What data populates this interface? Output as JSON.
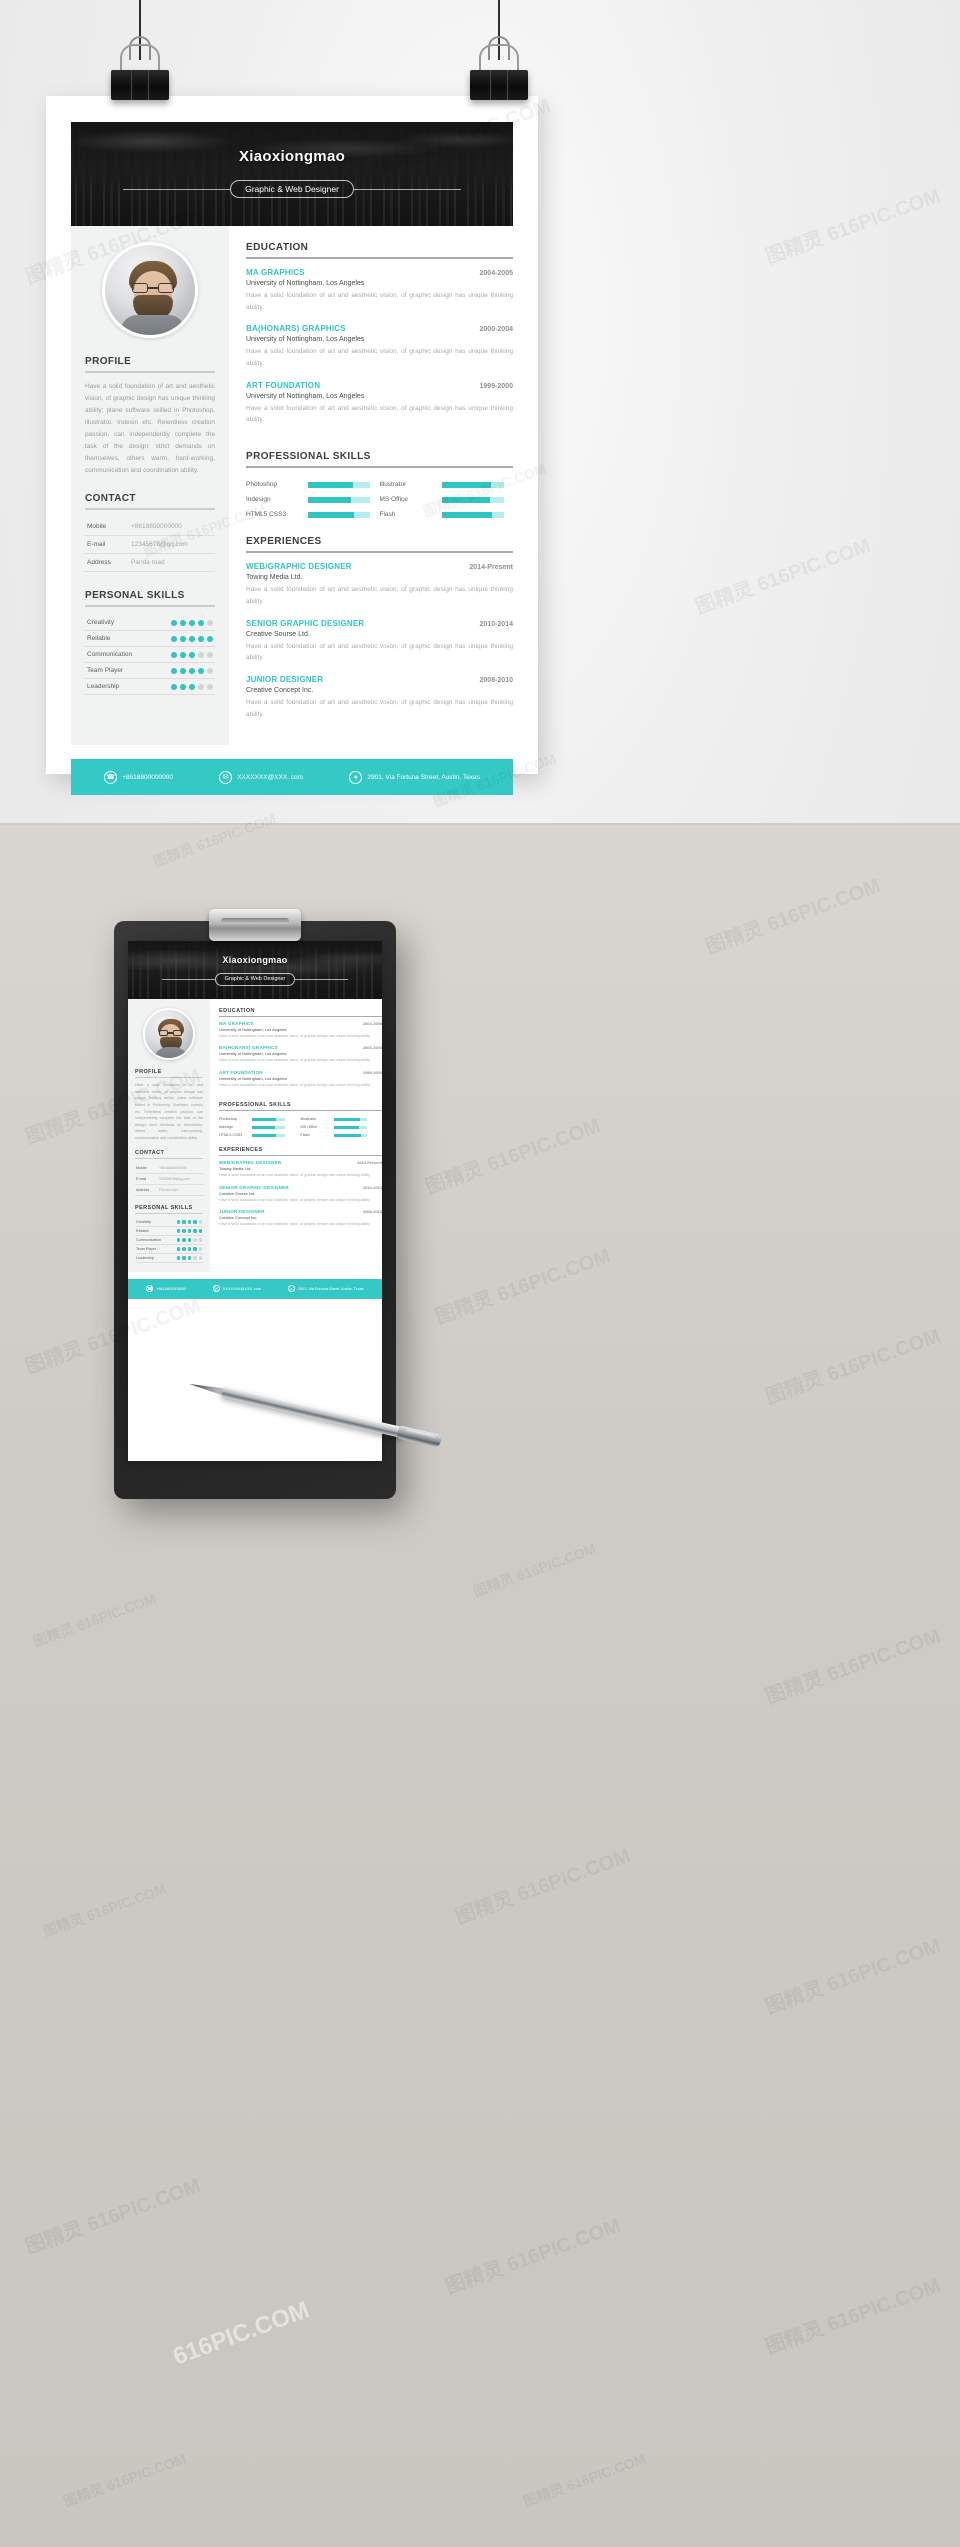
{
  "resume": {
    "name": "Xiaoxiongmao",
    "job_title": "Graphic & Web Designer",
    "profile": {
      "heading": "PROFILE",
      "text": "Have a solid foundation of art and aesthetic vision, of graphic design has unique thinking ability; plane software skilled in Photoshop, illustrator, Indesin etc. Relentless creation passion, can independently complete the task of the design; strict demands on themselves, others warm, hard-working, communication and coordination ability."
    },
    "contact": {
      "heading": "CONTACT",
      "rows": [
        {
          "label": "Mobile",
          "value": "+8618800000000"
        },
        {
          "label": "E-mail",
          "value": "12345678@qq.com"
        },
        {
          "label": "Address",
          "value": "Panda road"
        }
      ]
    },
    "personal_skills": {
      "heading": "PERSONAL SKILLS",
      "max_dots": 5,
      "rows": [
        {
          "label": "Creativity",
          "filled": 4
        },
        {
          "label": "Reliable",
          "filled": 5
        },
        {
          "label": "Communication",
          "filled": 3
        },
        {
          "label": "Team Player",
          "filled": 4
        },
        {
          "label": "Leadership",
          "filled": 3
        }
      ]
    },
    "education": {
      "heading": "EDUCATION",
      "items": [
        {
          "title": "MA GRAPHICS",
          "date": "2004-2005",
          "school": "University of Nottingham, Los Angeles",
          "desc": "Have a solid foundation of art and aesthetic vision, of graphic design has unique thinking ability."
        },
        {
          "title": "BA(HONARS) GRAPHICS",
          "date": "2000-2004",
          "school": "University of Nottingham, Los Angeles",
          "desc": "Have a solid foundation of art and aesthetic vision, of graphic design has unique thinking ability."
        },
        {
          "title": "ART FOUNDATION",
          "date": "1999-2000",
          "school": "University of Nottingham, Los Angeles",
          "desc": "Have a solid foundation of art and aesthetic vision, of graphic design has unique thinking ability."
        }
      ]
    },
    "professional_skills": {
      "heading": "PROFESSIONAL SKILLS",
      "items": [
        {
          "label": "Photoshop",
          "percent": 72
        },
        {
          "label": "Illustrator",
          "percent": 80
        },
        {
          "label": "Indesign",
          "percent": 70
        },
        {
          "label": "MS Office",
          "percent": 78
        },
        {
          "label": "HTML5 CSS3",
          "percent": 74
        },
        {
          "label": "Flash",
          "percent": 82
        }
      ]
    },
    "experiences": {
      "heading": "EXPERIENCES",
      "items": [
        {
          "title": "WEB/GRAPHIC DESIGNER",
          "date": "2014-Present",
          "company": "Towing Media Ltd.",
          "desc": "Have a solid foundation of art and aesthetic vision, of graphic design has unique thinking ability."
        },
        {
          "title": "SENIOR GRAPHIC DESIGNER",
          "date": "2010-2014",
          "company": "Creative Sourse Ltd.",
          "desc": "Have a solid foundation of art and aesthetic vision, of graphic design has unique thinking ability."
        },
        {
          "title": "JUNIOR DESIGNER",
          "date": "2008-2010",
          "company": "Creative Concept Inc.",
          "desc": "Have a solid foundation of art and aesthetic vision, of graphic design has unique thinking ability."
        }
      ]
    },
    "footer": {
      "phone": "+8618800000000",
      "email": "XXXXXXX@XXX. com",
      "address": "2901, Via Fortuna Street, Austin, Texas",
      "phone_icon": "phone-icon",
      "email_icon": "envelope-icon",
      "address_icon": "location-pin-icon"
    }
  },
  "theme": {
    "accent": "#2ec4c0",
    "accent_light": "#b6eceb",
    "footer_bg": "#35c9c5",
    "sidebar_bg": "#f1f2f2",
    "header_dark": "#1f1f1f"
  },
  "watermarks": {
    "text_a": "图精灵 616PIC.COM",
    "text_b": "616PIC.COM",
    "text_c": "图精灵"
  }
}
